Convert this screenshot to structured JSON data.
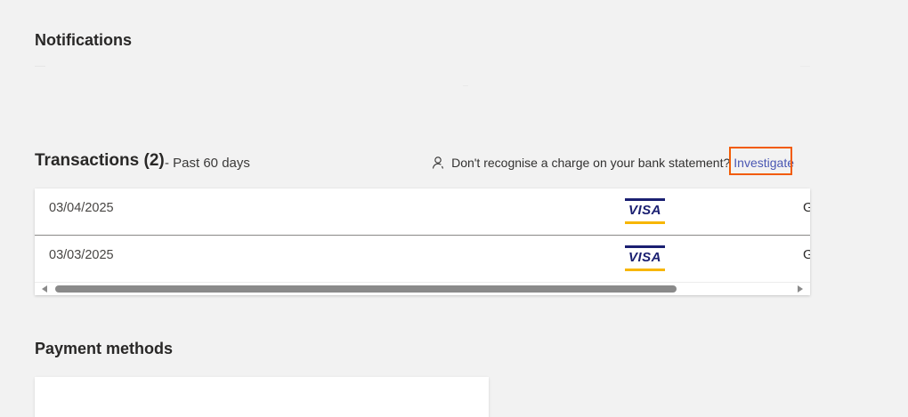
{
  "notifications": {
    "title": "Notifications"
  },
  "transactions": {
    "title": "Transactions (2)",
    "subtitle": "- Past 60 days",
    "help_text": "Don't recognise a charge on your bank statement?",
    "investigate_label": "Investigate",
    "rows": [
      {
        "date": "03/04/2025",
        "card_brand": "VISA",
        "truncated": "G"
      },
      {
        "date": "03/03/2025",
        "card_brand": "VISA",
        "truncated": "G"
      }
    ]
  },
  "payment_methods": {
    "title": "Payment methods"
  },
  "colors": {
    "background": "#f2f2f2",
    "link": "#4a57b3",
    "highlight": "#f25c05",
    "visa_blue": "#1a1f71",
    "visa_gold": "#f7b600"
  },
  "icons": {
    "person": "person-icon",
    "scroll_left": "chevron-left-icon",
    "scroll_right": "chevron-right-icon"
  }
}
